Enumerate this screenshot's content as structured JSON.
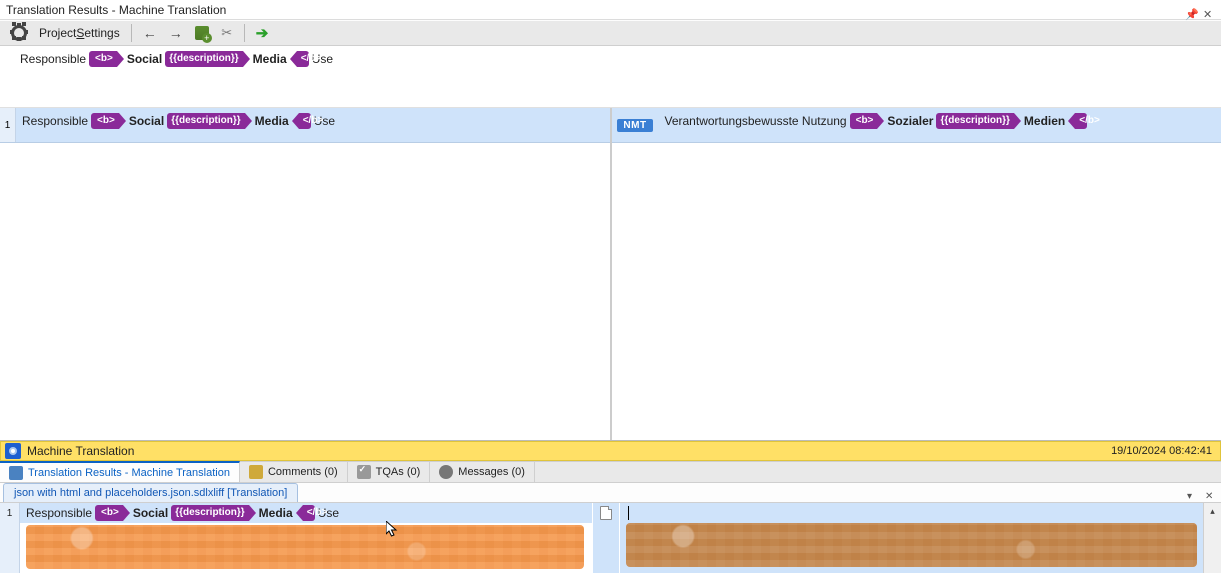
{
  "title": "Translation Results - Machine Translation",
  "toolbar": {
    "project_settings_prefix": "Project ",
    "project_settings_underlined": "S",
    "project_settings_suffix": "ettings"
  },
  "source_segment": {
    "tokens": [
      {
        "type": "text",
        "text": "Responsible ",
        "bold": false
      },
      {
        "type": "tag-open",
        "text": "<b>"
      },
      {
        "type": "text",
        "text": "Social",
        "bold": true
      },
      {
        "type": "tag-standalone",
        "text": "{{description}}"
      },
      {
        "type": "text",
        "text": "Media",
        "bold": true
      },
      {
        "type": "tag-close",
        "text": "</b>"
      },
      {
        "type": "text",
        "text": "Use",
        "bold": false
      }
    ]
  },
  "results": {
    "seg_no": "1",
    "status_label": "NMT",
    "source": [
      {
        "type": "text",
        "text": "Responsible ",
        "bold": false
      },
      {
        "type": "tag-open",
        "text": "<b>"
      },
      {
        "type": "text",
        "text": "Social",
        "bold": true
      },
      {
        "type": "tag-standalone",
        "text": "{{description}}"
      },
      {
        "type": "text",
        "text": "Media",
        "bold": true
      },
      {
        "type": "tag-close",
        "text": "</b>"
      },
      {
        "type": "text",
        "text": "Use",
        "bold": false
      }
    ],
    "target": [
      {
        "type": "text",
        "text": "Verantwortungsbewusste Nutzung",
        "bold": false
      },
      {
        "type": "tag-open",
        "text": "<b>"
      },
      {
        "type": "text",
        "text": "Sozialer",
        "bold": true
      },
      {
        "type": "tag-standalone",
        "text": "{{description}}"
      },
      {
        "type": "text",
        "text": "Medien",
        "bold": true
      },
      {
        "type": "tag-close",
        "text": "</b>"
      }
    ]
  },
  "mt_status": {
    "label": "Machine Translation",
    "timestamp": "19/10/2024 08:42:41"
  },
  "bottom_tabs": [
    {
      "id": "results",
      "label": "Translation Results - Machine Translation",
      "active": true,
      "icon": "db"
    },
    {
      "id": "comments",
      "label": "Comments (0)",
      "active": false,
      "icon": "comment"
    },
    {
      "id": "tqas",
      "label": "TQAs (0)",
      "active": false,
      "icon": "tqa"
    },
    {
      "id": "messages",
      "label": "Messages (0)",
      "active": false,
      "icon": "msg"
    }
  ],
  "file_tab": "json with html and placeholders.json.sdlxliff [Translation]",
  "editor": {
    "seg_no": "1",
    "source": [
      {
        "type": "text",
        "text": "Responsible ",
        "bold": false
      },
      {
        "type": "tag-open",
        "text": "<b>"
      },
      {
        "type": "text",
        "text": "Social",
        "bold": true
      },
      {
        "type": "tag-standalone",
        "text": "{{description}}"
      },
      {
        "type": "text",
        "text": "Media",
        "bold": true
      },
      {
        "type": "tag-close",
        "text": "</b>"
      },
      {
        "type": "text",
        "text": "Use",
        "bold": false
      }
    ]
  }
}
